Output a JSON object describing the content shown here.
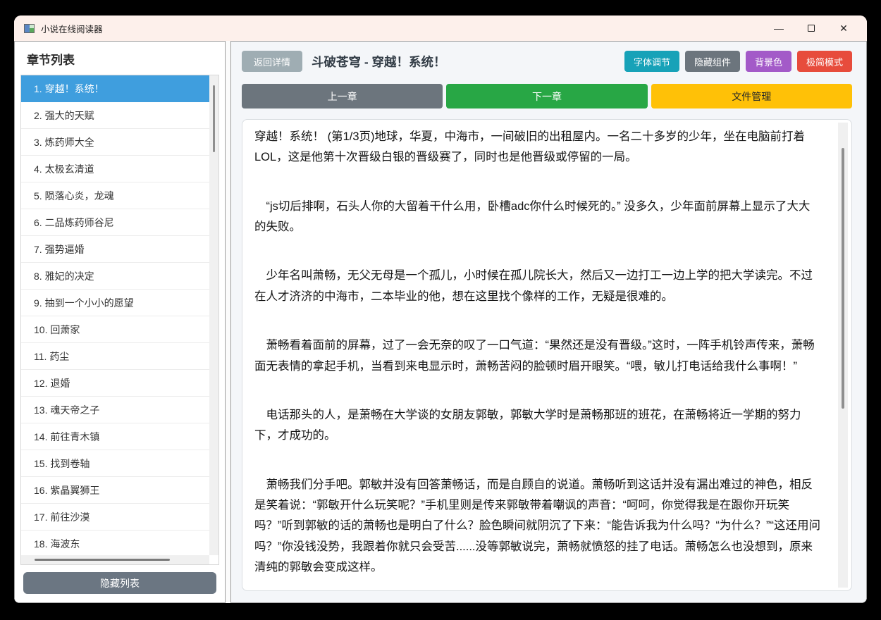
{
  "window": {
    "title": "小说在线阅读器",
    "controls": {
      "minimize": "—",
      "close": "✕"
    }
  },
  "sidebar": {
    "header": "章节列表",
    "selected_index": 0,
    "chapters": [
      "1. 穿越！系统！",
      "2. 强大的天赋",
      "3. 炼药师大全",
      "4. 太极玄清道",
      "5. 陨落心炎，龙魂",
      "6. 二品炼药师谷尼",
      "7. 强势逼婚",
      "8. 雅妃的决定",
      "9. 抽到一个小小的愿望",
      "10. 回萧家",
      "11. 药尘",
      "12. 退婚",
      "13. 魂天帝之子",
      "14. 前往青木镇",
      "15. 找到卷轴",
      "16. 紫晶翼狮王",
      "17. 前往沙漠",
      "18. 海波东"
    ],
    "hide_list_button": "隐藏列表"
  },
  "toolbar": {
    "back_button": "返回详情",
    "chapter_title": "斗破苍穹 - 穿越！系统！",
    "font_adjust_button": "字体调节",
    "hide_widgets_button": "隐藏组件",
    "background_color_button": "背景色",
    "minimal_mode_button": "极简模式"
  },
  "nav": {
    "prev_button": "上一章",
    "next_button": "下一章",
    "file_manager_button": "文件管理"
  },
  "reader": {
    "page_info": "第1/3页",
    "paragraphs": [
      "穿越！系统！ (第1/3页)地球，华夏，中海市，一间破旧的出租屋内。一名二十多岁的少年，坐在电脑前打着LOL，这是他第十次晋级白银的晋级赛了，同时也是他晋级或停留的一局。",
      "　“js切后排啊，石头人你的大留着干什么用，卧槽adc你什么时候死的。” 没多久，少年面前屏幕上显示了大大的失败。",
      "　少年名叫萧畅，无父无母是一个孤儿，小时候在孤儿院长大，然后又一边打工一边上学的把大学读完。不过在人才济济的中海市，二本毕业的他，想在这里找个像样的工作，无疑是很难的。",
      "　萧畅看着面前的屏幕，过了一会无奈的叹了一口气道：“果然还是没有晋级。”这时，一阵手机铃声传来，萧畅面无表情的拿起手机，当看到来电显示时，萧畅苦闷的脸顿时眉开眼笑。“喂，敏儿打电话给我什么事啊！”",
      "　电话那头的人，是萧畅在大学谈的女朋友郭敏，郭敏大学时是萧畅那班的班花，在萧畅将近一学期的努力下，才成功的。",
      "　萧畅我们分手吧。郭敏并没有回答萧畅话，而是自顾自的说道。萧畅听到这话并没有漏出难过的神色，相反是笑着说：“郭敏开什么玩笑呢？”手机里则是传来郭敏带着嘲讽的声音：“呵呵，你觉得我是在跟你开玩笑吗？”听到郭敏的话的萧畅也是明白了什么？脸色瞬间就阴沉了下来：“能告诉我为什么吗？“为什么？”“这还用问吗？”你没钱没势，我跟着你就只会受苦......没等郭敏说完，萧畅就愤怒的挂了电话。萧畅怎么也没想到，原来清纯的郭敏会变成这样。"
    ]
  },
  "colors": {
    "titlebar": "#fdf0eb",
    "selected_chapter": "#3f9ede",
    "teal": "#17a2b8",
    "gray": "#6c757d",
    "purple": "#a35ac8",
    "red": "#e74c3c",
    "green": "#28a745",
    "yellow": "#ffc107",
    "back_button": "#9fadb3",
    "hide_list_button": "#6b7682",
    "main_background": "#f4f6f9"
  }
}
